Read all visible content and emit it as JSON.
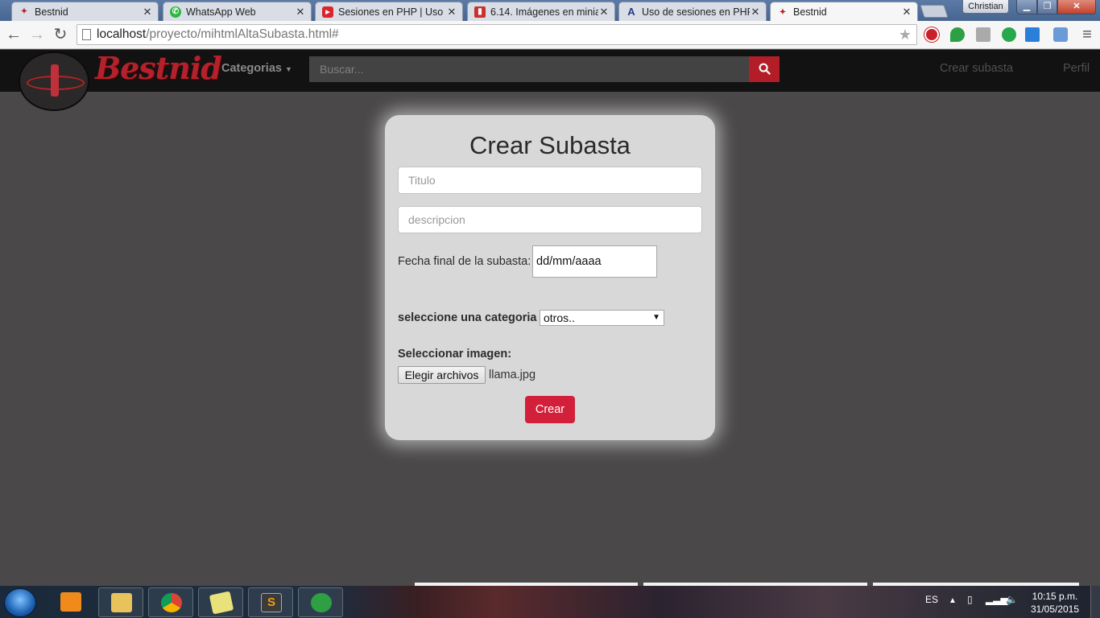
{
  "browser": {
    "tabs": [
      {
        "title": "Bestnid",
        "favicon": "bestnid-icon"
      },
      {
        "title": "WhatsApp Web",
        "favicon": "whatsapp-icon"
      },
      {
        "title": "Sesiones en PHP | Uso de",
        "favicon": "youtube-icon"
      },
      {
        "title": "6.14. Imágenes en miniat",
        "favicon": "book-icon"
      },
      {
        "title": "Uso de sesiones en PHP, ",
        "favicon": "a-letter-icon"
      },
      {
        "title": "Bestnid",
        "favicon": "bestnid-icon"
      }
    ],
    "user_name": "Christian",
    "url_host": "localhost",
    "url_path": "/proyecto/mihtmlAltaSubasta.html#"
  },
  "site": {
    "brand": "Bestnid",
    "categories_label": "Categorias",
    "search_placeholder": "Buscar...",
    "nav_create": "Crear subasta",
    "nav_profile": "Perfil"
  },
  "form": {
    "title": "Crear Subasta",
    "titulo_placeholder": "Titulo",
    "descripcion_placeholder": "descripcion",
    "fecha_label": "Fecha final de la subasta:",
    "fecha_value": "dd/mm/aaaa",
    "categoria_label": "seleccione una categoria",
    "categoria_value": "otros..",
    "imagen_label": "Seleccionar imagen:",
    "file_button": "Elegir archivos",
    "file_name": "llama.jpg",
    "submit": "Crear"
  },
  "taskbar": {
    "language": "ES",
    "time": "10:15 p.m.",
    "date": "31/05/2015"
  },
  "colors": {
    "accent": "#d21f3a",
    "navbar": "#121212",
    "page_bg": "#4a4849",
    "card_bg": "#d8d8d8"
  }
}
